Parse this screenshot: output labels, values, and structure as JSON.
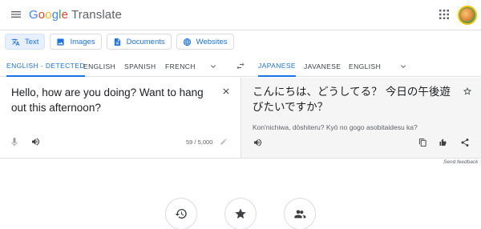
{
  "app": {
    "logo_letters": [
      "G",
      "o",
      "o",
      "g",
      "l",
      "e"
    ],
    "product": "Translate",
    "icons": {
      "menu": "hamburger-menu-icon",
      "apps": "apps-grid-icon",
      "avatar": "account-avatar"
    }
  },
  "modes": [
    {
      "label": "Text",
      "icon": "translate-icon",
      "active": true
    },
    {
      "label": "Images",
      "icon": "image-icon",
      "active": false
    },
    {
      "label": "Documents",
      "icon": "document-icon",
      "active": false
    },
    {
      "label": "Websites",
      "icon": "globe-icon",
      "active": false
    }
  ],
  "source_languages": [
    "ENGLISH - DETECTED",
    "ENGLISH",
    "SPANISH",
    "FRENCH"
  ],
  "target_languages": [
    "JAPANESE",
    "JAVANESE",
    "ENGLISH"
  ],
  "selected": {
    "source": "ENGLISH - DETECTED",
    "target": "JAPANESE"
  },
  "source": {
    "text": "Hello, how are you doing? Want to hang out this afternoon?",
    "char_count": "59 / 5,000"
  },
  "target": {
    "text": "こんにちは、どうしてる？ 今日の午後遊びたいですか？",
    "romanization": "Kon'nichiwa, dōshiteru? Kyō no gogo asobitaidesu ka?"
  },
  "feedback": "Send feedback",
  "colors": {
    "accent": "#1a73e8",
    "active_mode_bg": "#e8f0fe",
    "target_pane_bg": "#f5f5f5",
    "border": "#e0e0e0"
  }
}
